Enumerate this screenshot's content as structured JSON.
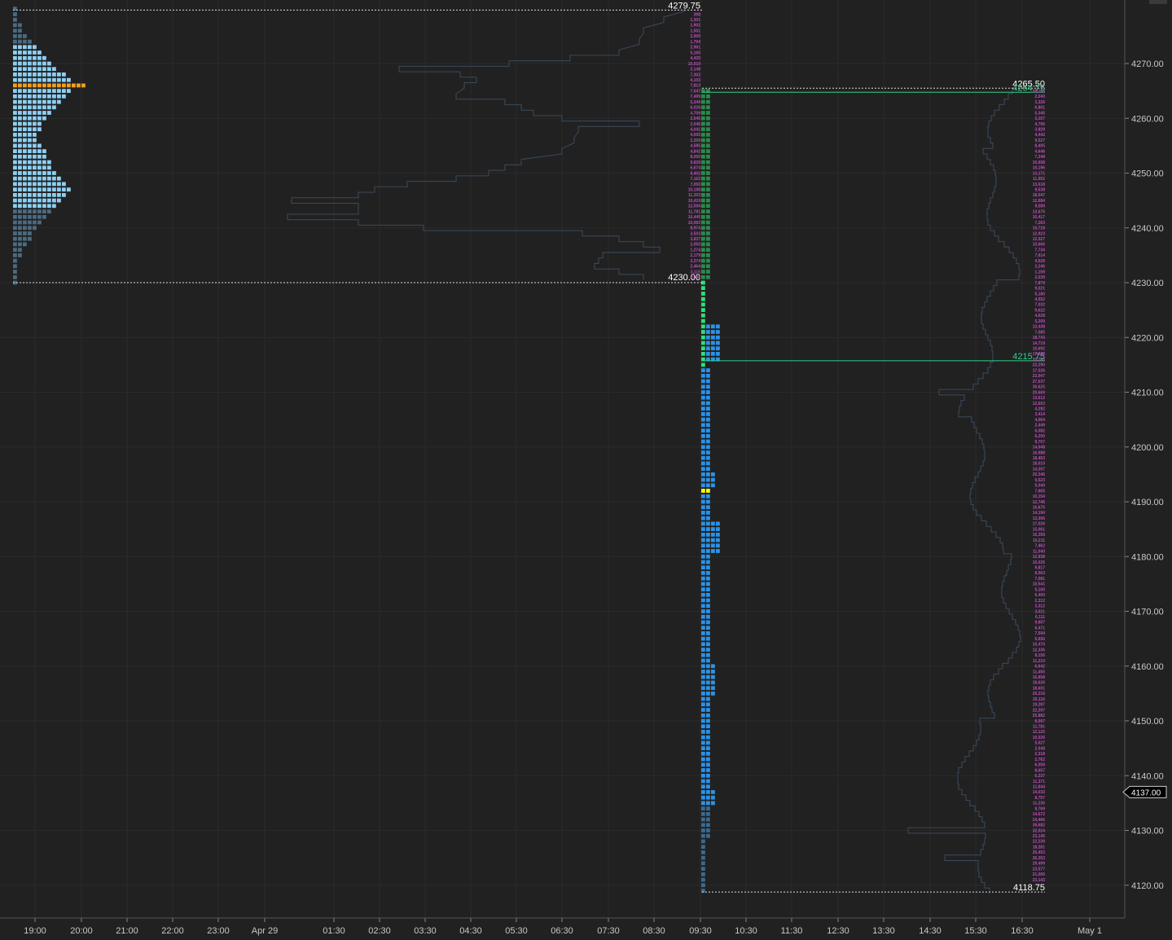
{
  "chart_data": {
    "type": "market-profile",
    "grid": true,
    "y_axis": {
      "side": "right",
      "ticks": [
        "4120.00",
        "4130.00",
        "4140.00",
        "4150.00",
        "4160.00",
        "4170.00",
        "4180.00",
        "4190.00",
        "4200.00",
        "4210.00",
        "4220.00",
        "4230.00",
        "4240.00",
        "4250.00",
        "4260.00",
        "4270.00"
      ],
      "range": [
        4113,
        4281
      ]
    },
    "x_axis": {
      "ticks": [
        "19:00",
        "20:00",
        "21:00",
        "22:00",
        "23:00",
        "Apr 29",
        "01:30",
        "02:30",
        "03:30",
        "04:30",
        "05:30",
        "06:30",
        "07:30",
        "08:30",
        "09:30",
        "10:30",
        "11:30",
        "12:30",
        "13:30",
        "14:30",
        "15:30",
        "16:30",
        "May 1"
      ]
    },
    "last_price": "4137.00",
    "colors": {
      "overnight_profile": "#8ecff2",
      "overnight_tail": "#4a6b80",
      "overnight_poc": "#f0a020",
      "rth_profile": "#2b93e8",
      "rth_opening": "#2de07a",
      "rth_early": "#2a8a4c",
      "rth_poc": "#ffff00",
      "rth_tail": "#3a6a90",
      "volume_line": "#3a4a5e",
      "volume_text": "#c04ec0",
      "value_line": "#2ed08a"
    },
    "profiles": [
      {
        "id": "overnight",
        "high": "4279.75",
        "low": "4230.00",
        "poc": 4266.5,
        "tpo_rows": [
          [
            4280,
            1
          ],
          [
            4279,
            1
          ],
          [
            4278,
            1
          ],
          [
            4277,
            2
          ],
          [
            4276,
            2
          ],
          [
            4275,
            3
          ],
          [
            4274,
            4
          ],
          [
            4273,
            5
          ],
          [
            4272,
            6
          ],
          [
            4271,
            7
          ],
          [
            4270,
            8
          ],
          [
            4269,
            9
          ],
          [
            4268,
            11
          ],
          [
            4267,
            12
          ],
          [
            4266,
            13
          ],
          [
            4265,
            12
          ],
          [
            4264,
            11
          ],
          [
            4263,
            10
          ],
          [
            4262,
            9
          ],
          [
            4261,
            8
          ],
          [
            4260,
            7
          ],
          [
            4259,
            6
          ],
          [
            4258,
            6
          ],
          [
            4257,
            5
          ],
          [
            4256,
            5
          ],
          [
            4255,
            6
          ],
          [
            4254,
            7
          ],
          [
            4253,
            7
          ],
          [
            4252,
            8
          ],
          [
            4251,
            8
          ],
          [
            4250,
            9
          ],
          [
            4249,
            10
          ],
          [
            4248,
            11
          ],
          [
            4247,
            12
          ],
          [
            4246,
            11
          ],
          [
            4245,
            10
          ],
          [
            4244,
            9
          ],
          [
            4243,
            8
          ],
          [
            4242,
            7
          ],
          [
            4241,
            6
          ],
          [
            4240,
            5
          ],
          [
            4239,
            4
          ],
          [
            4238,
            4
          ],
          [
            4237,
            3
          ],
          [
            4236,
            2
          ],
          [
            4235,
            2
          ],
          [
            4234,
            1
          ],
          [
            4233,
            1
          ],
          [
            4232,
            1
          ],
          [
            4231,
            1
          ],
          [
            4230,
            1
          ]
        ],
        "volume_labels": [
          "398",
          "1,301",
          "1,902",
          "1,501",
          "2,000",
          "1,794",
          "2,961",
          "5,165",
          "4,435",
          "10,019",
          "2,148",
          "7,302",
          "4,103",
          "7,813",
          "7,547",
          "7,499",
          "5,344",
          "6,026",
          "4,709",
          "2,545",
          "2,046",
          "4,041",
          "4,005",
          "2,359",
          "4,585",
          "4,842",
          "8,050",
          "9,828",
          "6,674",
          "8,402",
          "7,162",
          "7,050",
          "10,198",
          "11,353",
          "10,419",
          "12,594",
          "11,781",
          "10,445",
          "10,083",
          "8,974",
          "3,503",
          "3,837",
          "2,050",
          "1,274",
          "2,179",
          "3,374",
          "2,464",
          "3,115",
          "2,094"
        ]
      },
      {
        "id": "rth",
        "high": "4265.50",
        "low": "4118.75",
        "poc": 4192.5,
        "value_area_high": "4264.75",
        "value_area_low": "4215.75",
        "volume_labels": [
          "19,183",
          "2,040",
          "3,326",
          "6,801",
          "5,345",
          "3,157",
          "4,706",
          "3,829",
          "4,442",
          "9,527",
          "8,405",
          "4,646",
          "7,348",
          "10,658",
          "10,196",
          "13,171",
          "11,952",
          "13,618",
          "9,538",
          "18,547",
          "12,684",
          "9,589",
          "13,675",
          "10,417",
          "7,263",
          "10,718",
          "12,923",
          "12,027",
          "10,666",
          "7,734",
          "7,614",
          "4,528",
          "2,246",
          "1,159",
          "2,039",
          "7,879",
          "9,021",
          "5,180",
          "4,552",
          "7,032",
          "9,622",
          "4,628",
          "5,209",
          "13,438",
          "7,585",
          "18,743",
          "14,719",
          "10,692",
          "17,288",
          "10,745",
          "22,290",
          "17,026",
          "23,947",
          "27,037",
          "30,625",
          "20,669",
          "13,612",
          "12,653",
          "4,292",
          "3,414",
          "4,064",
          "2,449",
          "6,082",
          "6,200",
          "9,707",
          "14,048",
          "16,988",
          "18,453",
          "18,010",
          "14,307",
          "20,346",
          "9,523",
          "5,040",
          "7,905",
          "10,154",
          "12,746",
          "16,675",
          "14,194",
          "13,306",
          "17,026",
          "15,061",
          "15,359",
          "10,211",
          "7,462",
          "11,040",
          "12,938",
          "10,026",
          "9,817",
          "8,563",
          "7,081",
          "10,541",
          "5,100",
          "6,400",
          "2,312",
          "3,312",
          "3,021",
          "6,111",
          "9,807",
          "6,471",
          "7,594",
          "5,656",
          "10,470",
          "12,336",
          "8,156",
          "11,210",
          "6,642",
          "11,455",
          "16,858",
          "18,626",
          "18,601",
          "20,216",
          "20,116",
          "19,287",
          "22,297",
          "25,882",
          "8,097",
          "11,781",
          "12,125",
          "10,026",
          "5,027",
          "2,048",
          "2,318",
          "2,762",
          "6,059",
          "8,657",
          "6,337",
          "11,371",
          "11,844",
          "14,033",
          "8,757",
          "11,236",
          "9,769",
          "14,672",
          "24,466",
          "39,682",
          "32,024",
          "23,145",
          "22,239",
          "18,281",
          "25,453",
          "26,353",
          "29,499",
          "23,577",
          "21,006",
          "23,143"
        ]
      }
    ]
  }
}
